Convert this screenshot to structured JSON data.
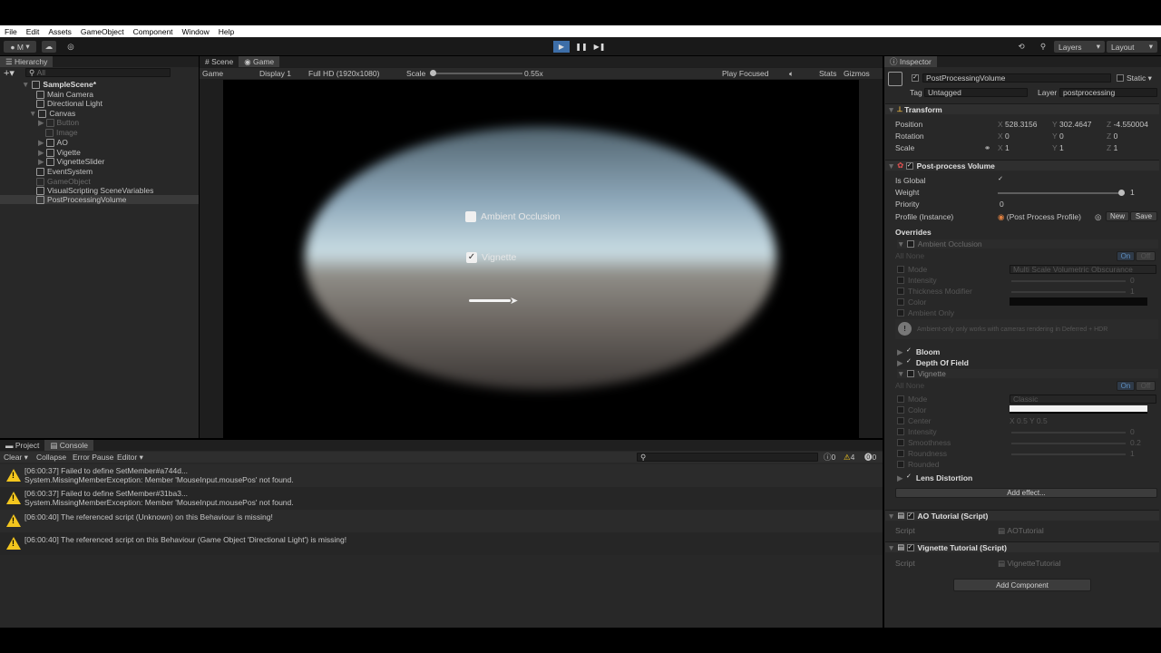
{
  "menu": [
    "File",
    "Edit",
    "Assets",
    "GameObject",
    "Component",
    "Window",
    "Help"
  ],
  "toolbar": {
    "account": "M",
    "layers": "Layers",
    "layout": "Layout"
  },
  "hierarchy": {
    "tab": "Hierarchy",
    "search": "All",
    "items": [
      {
        "label": "SampleScene*"
      },
      {
        "label": "Main Camera"
      },
      {
        "label": "Directional Light"
      },
      {
        "label": "Canvas"
      },
      {
        "label": "Button"
      },
      {
        "label": "Image"
      },
      {
        "label": "AO"
      },
      {
        "label": "Vigette"
      },
      {
        "label": "VignetteSlider"
      },
      {
        "label": "EventSystem"
      },
      {
        "label": "GameObject"
      },
      {
        "label": "VisualScripting SceneVariables"
      },
      {
        "label": "PostProcessingVolume"
      }
    ]
  },
  "game": {
    "tabs": [
      "Scene",
      "Game"
    ],
    "mode": "Game",
    "display": "Display 1",
    "resolution": "Full HD (1920x1080)",
    "scale_label": "Scale",
    "scale_value": "0.55x",
    "play_focused": "Play Focused",
    "stats": "Stats",
    "gizmos": "Gizmos",
    "ui": {
      "ao_label": "Ambient Occlusion",
      "vignette_label": "Vignette",
      "ao_checked": false,
      "vignette_checked": true
    }
  },
  "console": {
    "tabs": [
      "Project",
      "Console"
    ],
    "buttons": [
      "Clear",
      "Collapse",
      "Error Pause",
      "Editor"
    ],
    "counts": {
      "info": "0",
      "warn": "4",
      "error": "0"
    },
    "messages": [
      {
        "line1": "[06:00:37] Failed to define SetMember#a744d...",
        "line2": "System.MissingMemberException: Member 'MouseInput.mousePos' not found."
      },
      {
        "line1": "[06:00:37] Failed to define SetMember#31ba3...",
        "line2": "System.MissingMemberException: Member 'MouseInput.mousePos' not found."
      },
      {
        "line1": "[06:00:40] The referenced script (Unknown) on this Behaviour is missing!",
        "line2": ""
      },
      {
        "line1": "[06:00:40] The referenced script on this Behaviour (Game Object 'Directional Light') is missing!",
        "line2": ""
      }
    ]
  },
  "inspector": {
    "tab": "Inspector",
    "object_name": "PostProcessingVolume",
    "static": "Static",
    "tag_label": "Tag",
    "tag": "Untagged",
    "layer_label": "Layer",
    "layer": "postprocessing",
    "transform": {
      "title": "Transform",
      "position": {
        "label": "Position",
        "x": "528.3156",
        "y": "302.4647",
        "z": "-4.550004"
      },
      "rotation": {
        "label": "Rotation",
        "x": "0",
        "y": "0",
        "z": "0"
      },
      "scale": {
        "label": "Scale",
        "x": "1",
        "y": "1",
        "z": "1"
      }
    },
    "volume": {
      "title": "Post-process Volume",
      "is_global": "Is Global",
      "weight": "Weight",
      "weight_value": "1",
      "priority": "Priority",
      "priority_value": "0",
      "profile": "Profile (Instance)",
      "profile_value": "(Post Process Profile)",
      "new": "New",
      "save": "Save",
      "overrides": "Overrides",
      "ao": {
        "title": "Ambient Occlusion",
        "all": "All",
        "none": "None",
        "on": "On",
        "off": "Off",
        "rows": [
          {
            "label": "Mode",
            "value": "Multi Scale Volumetric Obscurance"
          },
          {
            "label": "Intensity",
            "value": "0"
          },
          {
            "label": "Thickness Modifier",
            "value": "1"
          },
          {
            "label": "Color",
            "value": ""
          },
          {
            "label": "Ambient Only",
            "value": ""
          }
        ],
        "note": "Ambient-only only works with cameras rendering in Deferred + HDR"
      },
      "bloom": "Bloom",
      "dof": "Depth Of Field",
      "vignette": {
        "title": "Vignette",
        "all": "All",
        "none": "None",
        "on": "On",
        "off": "Off",
        "rows": [
          {
            "label": "Mode",
            "value": "Classic"
          },
          {
            "label": "Color",
            "value": ""
          },
          {
            "label": "Center",
            "value": "X 0.5    Y 0.5"
          },
          {
            "label": "Intensity",
            "value": "0"
          },
          {
            "label": "Smoothness",
            "value": "0.2"
          },
          {
            "label": "Roundness",
            "value": "1"
          },
          {
            "label": "Rounded",
            "value": ""
          }
        ]
      },
      "lens": "Lens Distortion",
      "add_effect": "Add effect..."
    },
    "ao_script": {
      "title": "AO Tutorial (Script)",
      "label": "Script",
      "value": "AOTutorial"
    },
    "vig_script": {
      "title": "Vignette Tutorial (Script)",
      "label": "Script",
      "value": "VignetteTutorial"
    },
    "add_component": "Add Component"
  },
  "colors": {
    "accent": "#3d6ea8",
    "warn": "#f3c61e",
    "panel": "#282828"
  }
}
